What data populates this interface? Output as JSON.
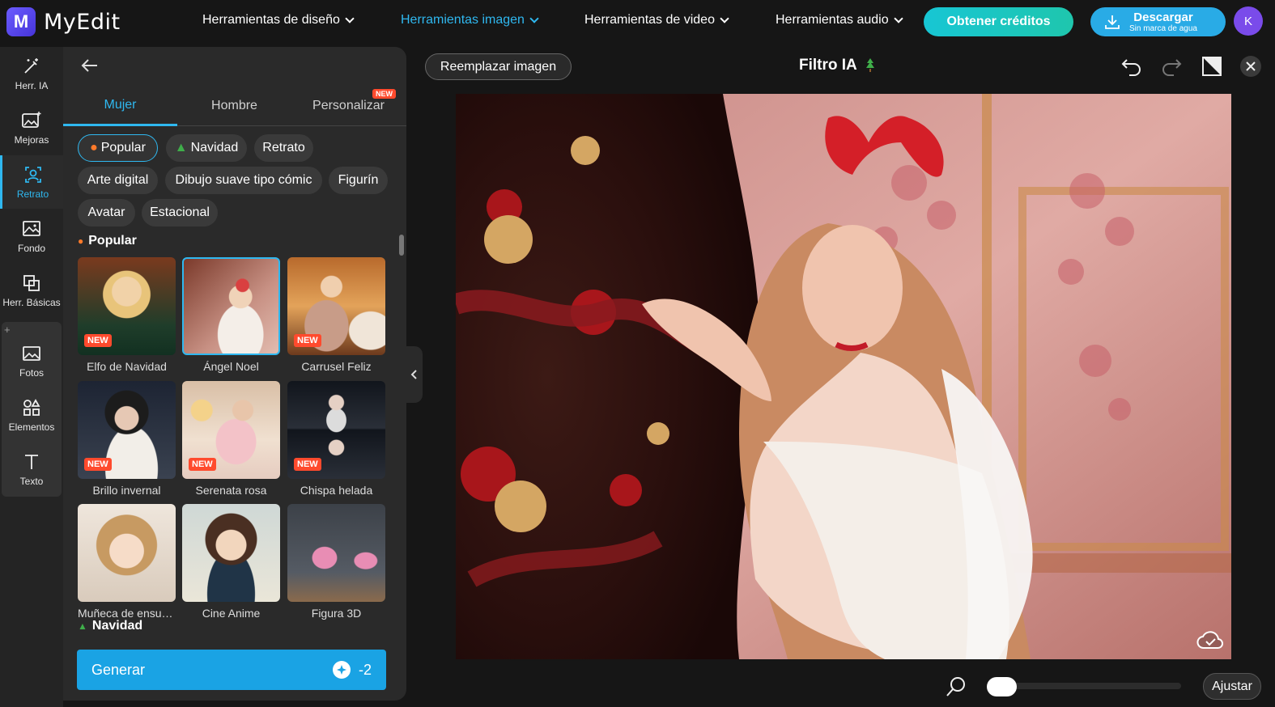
{
  "app": {
    "name": "MyEdit",
    "logo_letter": "M",
    "accent": "#2fb8f0"
  },
  "topnav": {
    "items": [
      {
        "label": "Herramientas de diseño",
        "active": false
      },
      {
        "label": "Herramientas imagen",
        "active": true
      },
      {
        "label": "Herramientas de video",
        "active": false
      },
      {
        "label": "Herramientas audio",
        "active": false
      }
    ],
    "credits_label": "Obtener créditos",
    "download_label": "Descargar",
    "download_sub": "Sin marca de agua",
    "avatar_letter": "K"
  },
  "leftbar": {
    "items": [
      {
        "label": "Herr. IA",
        "icon": "magic-wand-icon"
      },
      {
        "label": "Mejoras",
        "icon": "image-sparkle-icon"
      },
      {
        "label": "Retrato",
        "icon": "portrait-icon",
        "active": true
      },
      {
        "label": "Fondo",
        "icon": "background-icon"
      },
      {
        "label": "Herr. Básicas",
        "icon": "crop-icon"
      },
      {
        "label": "Fotos",
        "icon": "photos-icon"
      },
      {
        "label": "Elementos",
        "icon": "elements-icon"
      },
      {
        "label": "Texto",
        "icon": "text-icon"
      }
    ]
  },
  "panel": {
    "tabs": [
      {
        "label": "Mujer",
        "active": true
      },
      {
        "label": "Hombre"
      },
      {
        "label": "Personalizar",
        "badge": "NEW"
      }
    ],
    "chips": [
      {
        "label": "Popular",
        "icon": "flame-icon",
        "active": true
      },
      {
        "label": "Navidad",
        "icon": "tree-icon"
      },
      {
        "label": "Retrato"
      },
      {
        "label": "Arte digital"
      },
      {
        "label": "Dibujo suave tipo cómic"
      },
      {
        "label": "Figurín"
      },
      {
        "label": "Avatar"
      },
      {
        "label": "Estacional"
      }
    ],
    "section_popular": "Popular",
    "section_navidad": "Navidad",
    "new_badge": "NEW",
    "cards": [
      {
        "label": "Elfo de Navidad",
        "new": true
      },
      {
        "label": "Ángel Noel",
        "selected": true
      },
      {
        "label": "Carrusel Feliz",
        "new": true
      },
      {
        "label": "Brillo invernal",
        "new": true
      },
      {
        "label": "Serenata rosa",
        "new": true
      },
      {
        "label": "Chispa helada",
        "new": true
      },
      {
        "label": "Muñeca de ensue..."
      },
      {
        "label": "Cine Anime"
      },
      {
        "label": "Figura 3D"
      }
    ],
    "generate_label": "Generar",
    "generate_cost": "-2"
  },
  "editor": {
    "replace_label": "Reemplazar imagen",
    "title": "Filtro IA",
    "fit_label": "Ajustar",
    "zoom": 0.08
  }
}
